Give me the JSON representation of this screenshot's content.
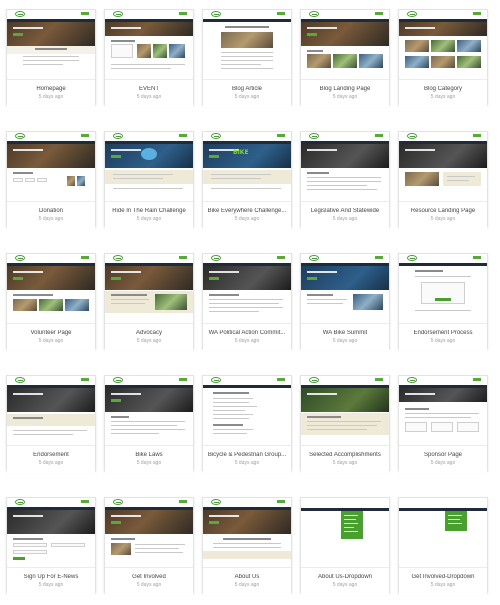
{
  "cards": [
    {
      "title": "Homepage",
      "meta": "5 days ago"
    },
    {
      "title": "EVENT",
      "meta": "5 days ago"
    },
    {
      "title": "Blog Article",
      "meta": "5 days ago"
    },
    {
      "title": "Blog Landing Page",
      "meta": "5 days ago"
    },
    {
      "title": "Blog Category",
      "meta": "5 days ago"
    },
    {
      "title": "Donation",
      "meta": "5 days ago"
    },
    {
      "title": "Ride In The Rain Challenge",
      "meta": "5 days ago"
    },
    {
      "title": "Bike Everywhere Challenge...",
      "meta": "5 days ago"
    },
    {
      "title": "Legislative And Statewide",
      "meta": "5 days ago"
    },
    {
      "title": "Resource Landing Page",
      "meta": "5 days ago"
    },
    {
      "title": "Volunteer Page",
      "meta": "5 days ago"
    },
    {
      "title": "Advocacy",
      "meta": "5 days ago"
    },
    {
      "title": "WA Political Action Commit...",
      "meta": "5 days ago"
    },
    {
      "title": "WA Bike Summit",
      "meta": "5 days ago"
    },
    {
      "title": "Endorsement Process",
      "meta": "5 days ago"
    },
    {
      "title": "Endorsement",
      "meta": "5 days ago"
    },
    {
      "title": "Bike Laws",
      "meta": "5 days ago"
    },
    {
      "title": "Bicycle & Pedestrian Group...",
      "meta": "5 days ago"
    },
    {
      "title": "Selected Accomplishments",
      "meta": "5 days ago"
    },
    {
      "title": "Sponsor Page",
      "meta": "5 days ago"
    },
    {
      "title": "Sign Up For E-News",
      "meta": "5 days ago"
    },
    {
      "title": "Get Involved",
      "meta": "5 days ago"
    },
    {
      "title": "About Us",
      "meta": "5 days ago"
    },
    {
      "title": "About Us-Dropdown",
      "meta": "5 days ago"
    },
    {
      "title": "Get Involved-Dropdown",
      "meta": "5 days ago"
    }
  ],
  "thumb_labels": {
    "bike_everywhere": "BIKE"
  },
  "colors": {
    "brand_green": "#4aa02f",
    "nav_navy": "#1d2b3a",
    "band_cream": "#efe9d8"
  }
}
